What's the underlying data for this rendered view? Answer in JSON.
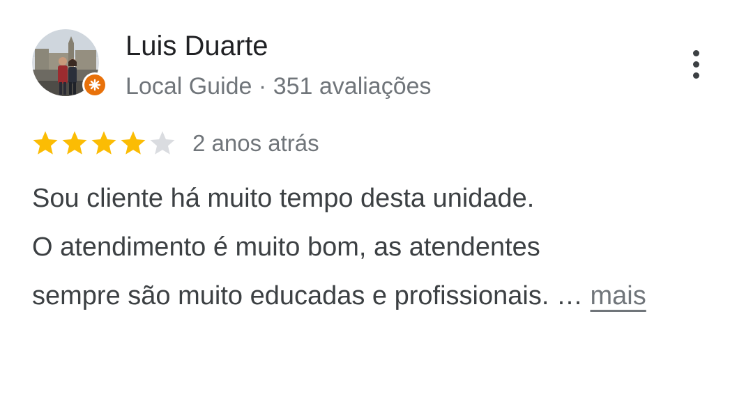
{
  "author": {
    "name": "Luis Duarte",
    "badge": "Local Guide",
    "separator": "·",
    "reviews_count": "351 avaliações"
  },
  "icons": {
    "avatar": "profile-photo",
    "guide_badge": "local-guide-badge-icon",
    "menu": "more-vert-icon",
    "star_filled": "star-icon",
    "star_empty": "star-outline-icon"
  },
  "rating": {
    "value": 4,
    "max": 5
  },
  "review": {
    "date": "2 anos atrás",
    "lines": [
      "Sou cliente há muito tempo desta unidade.",
      "O atendimento é muito bom, as atendentes",
      "sempre são muito educadas e profissionais. …"
    ],
    "more_label": "mais"
  },
  "colors": {
    "star_filled": "#fbbc04",
    "star_empty": "#dadce0",
    "badge": "#e8710a",
    "secondary_text": "#70757a"
  }
}
